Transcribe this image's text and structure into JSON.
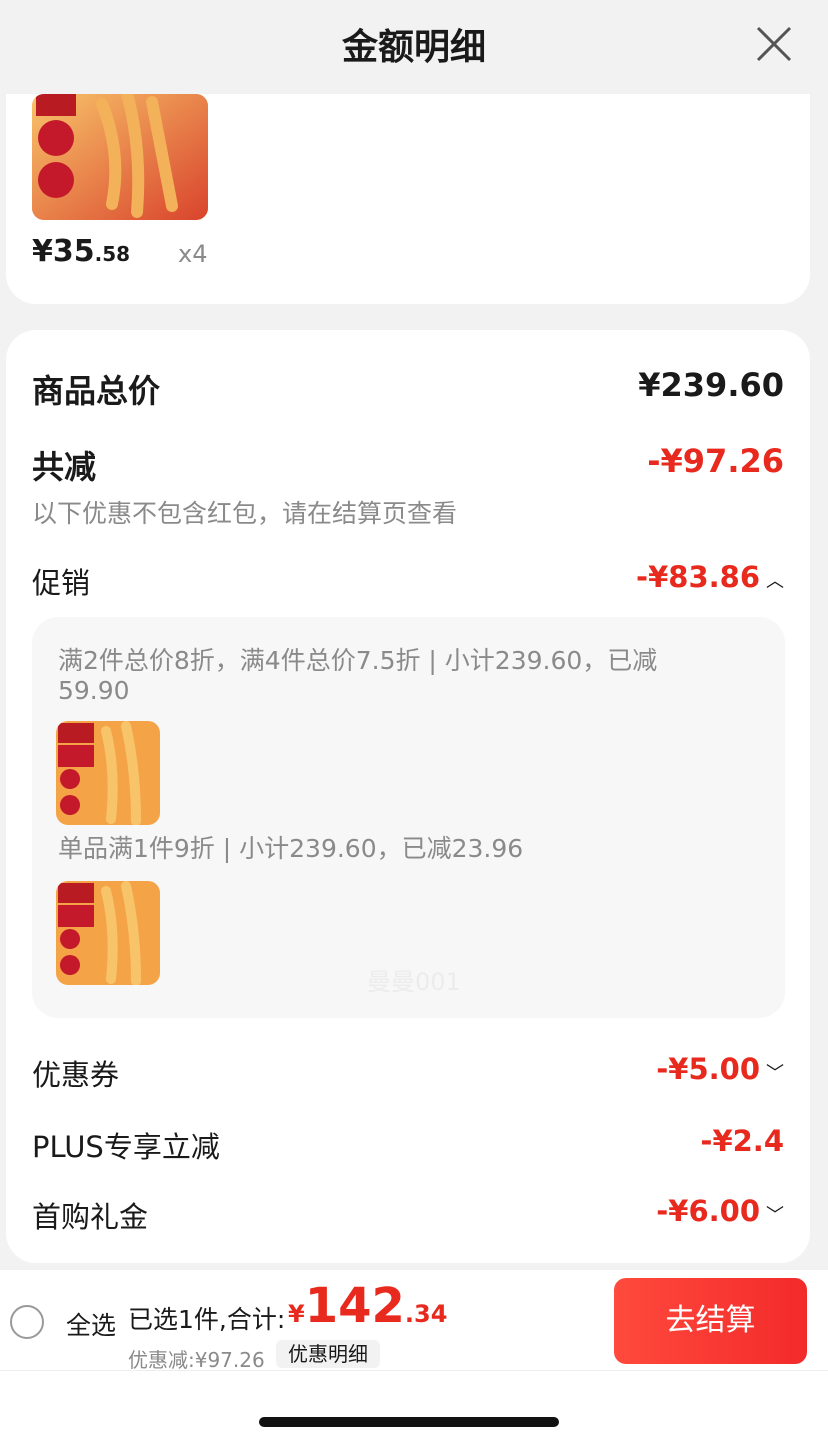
{
  "header": {
    "title": "金额明细"
  },
  "top_item": {
    "price_int": "¥35",
    "price_dec": ".58",
    "qty": "x4"
  },
  "summary": {
    "total_label": "商品总价",
    "total_value": "¥239.60",
    "reduce_label": "共减",
    "reduce_value": "-¥97.26",
    "note": "以下优惠不包含红包，请在结算页查看",
    "promo_label": "促销",
    "promo_value": "-¥83.86",
    "promo_lines": [
      "满2件总价8折，满4件总价7.5折 | 小计239.60，已减",
      "59.90",
      "单品满1件9折 | 小计239.60，已减23.96"
    ],
    "watermark": "曼曼001",
    "coupon_label": "优惠券",
    "coupon_value": "-¥5.00",
    "plus_label": "PLUS专享立减",
    "plus_value": "-¥2.4",
    "gift_label": "首购礼金",
    "gift_value": "-¥6.00"
  },
  "bottom": {
    "select_all": "全选",
    "selected": "已选1件,合计:",
    "yen": "¥",
    "total_int": "142",
    "total_dec": ".34",
    "discount": "优惠减:¥97.26",
    "detail_btn": "优惠明细",
    "checkout": "去结算"
  },
  "colors": {
    "accent_red": "#e8291d",
    "background": "#f2f2f2"
  },
  "icons": [
    "close-icon",
    "chevron-up-icon",
    "chevron-down-icon",
    "checkbox-icon"
  ]
}
